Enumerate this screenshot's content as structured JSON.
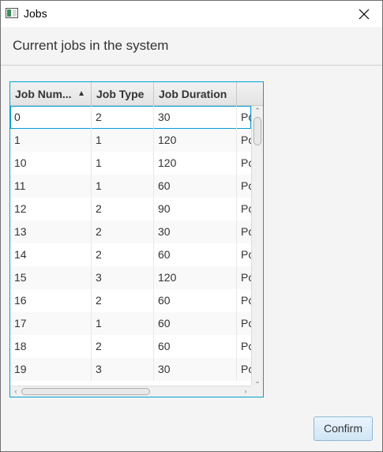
{
  "window": {
    "title": "Jobs",
    "icon": "app-window-icon",
    "close_icon": "close-icon"
  },
  "header": {
    "text": "Current jobs in the system"
  },
  "table": {
    "columns": [
      {
        "label": "Job Num...",
        "sorted": "ascending"
      },
      {
        "label": "Job Type"
      },
      {
        "label": "Job Duration"
      },
      {
        "label": ""
      }
    ],
    "rows": [
      [
        "0",
        "2",
        "30",
        "Pc"
      ],
      [
        "1",
        "1",
        "120",
        "Pc"
      ],
      [
        "10",
        "1",
        "120",
        "Pc"
      ],
      [
        "11",
        "1",
        "60",
        "Pc"
      ],
      [
        "12",
        "2",
        "90",
        "Pc"
      ],
      [
        "13",
        "2",
        "30",
        "Pc"
      ],
      [
        "14",
        "2",
        "60",
        "Pc"
      ],
      [
        "15",
        "3",
        "120",
        "Pc"
      ],
      [
        "16",
        "2",
        "60",
        "Pc"
      ],
      [
        "17",
        "1",
        "60",
        "Pc"
      ],
      [
        "18",
        "2",
        "60",
        "Pc"
      ],
      [
        "19",
        "3",
        "30",
        "Pc"
      ]
    ],
    "focused_row": 0
  },
  "footer": {
    "confirm_label": "Confirm"
  },
  "colors": {
    "focus_border": "#039ed3",
    "button_bg": "#cfe6f5"
  }
}
